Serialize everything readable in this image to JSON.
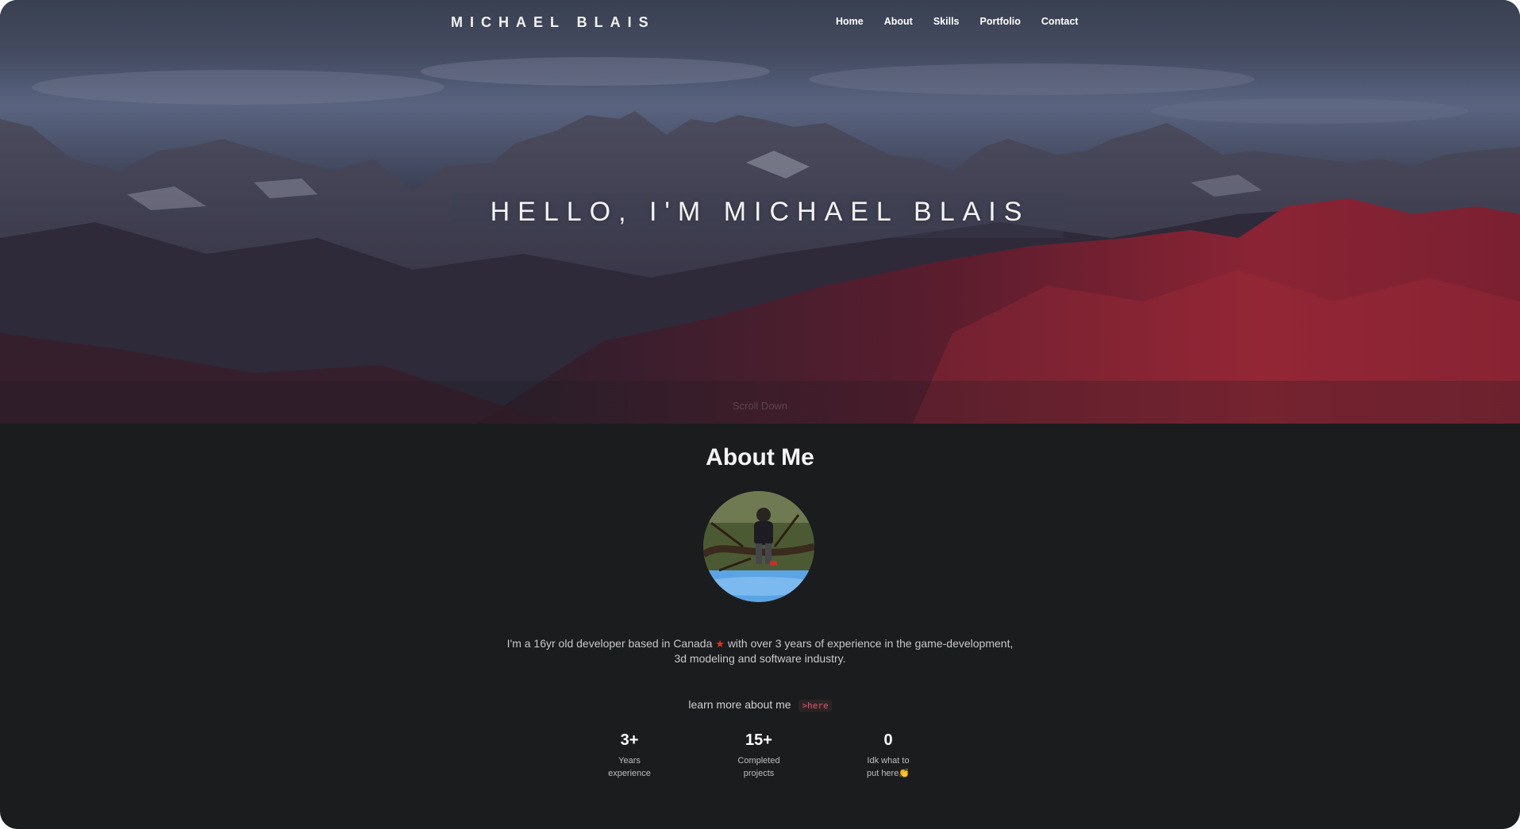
{
  "brand": "MICHAEL BLAIS",
  "nav": {
    "items": [
      {
        "label": "Home"
      },
      {
        "label": "About"
      },
      {
        "label": "Skills"
      },
      {
        "label": "Portfolio"
      },
      {
        "label": "Contact"
      }
    ]
  },
  "hero": {
    "title": "HELLO, I'M MICHAEL BLAIS",
    "scroll_hint": "Scroll Down"
  },
  "about": {
    "title": "About Me",
    "bio_line1_before": "I'm a 16yr old developer based in Canada",
    "bio_line1_after": " with over 3 years of experience in the game-development,",
    "bio_line2": "3d modeling and software industry.",
    "leaf_icon": "maple-leaf",
    "learn_more_text": "learn more about me",
    "learn_more_link": ">here"
  },
  "stats": [
    {
      "value": "3+",
      "label_line1": "Years",
      "label_line2": "experience"
    },
    {
      "value": "15+",
      "label_line1": "Completed",
      "label_line2": "projects"
    },
    {
      "value": "0",
      "label_line1": "Idk what to",
      "label_line2": "put here👏"
    }
  ],
  "colors": {
    "page_background": "#1b1c1e",
    "accent_link": "#e4576a",
    "leaf": "#e0331d"
  }
}
